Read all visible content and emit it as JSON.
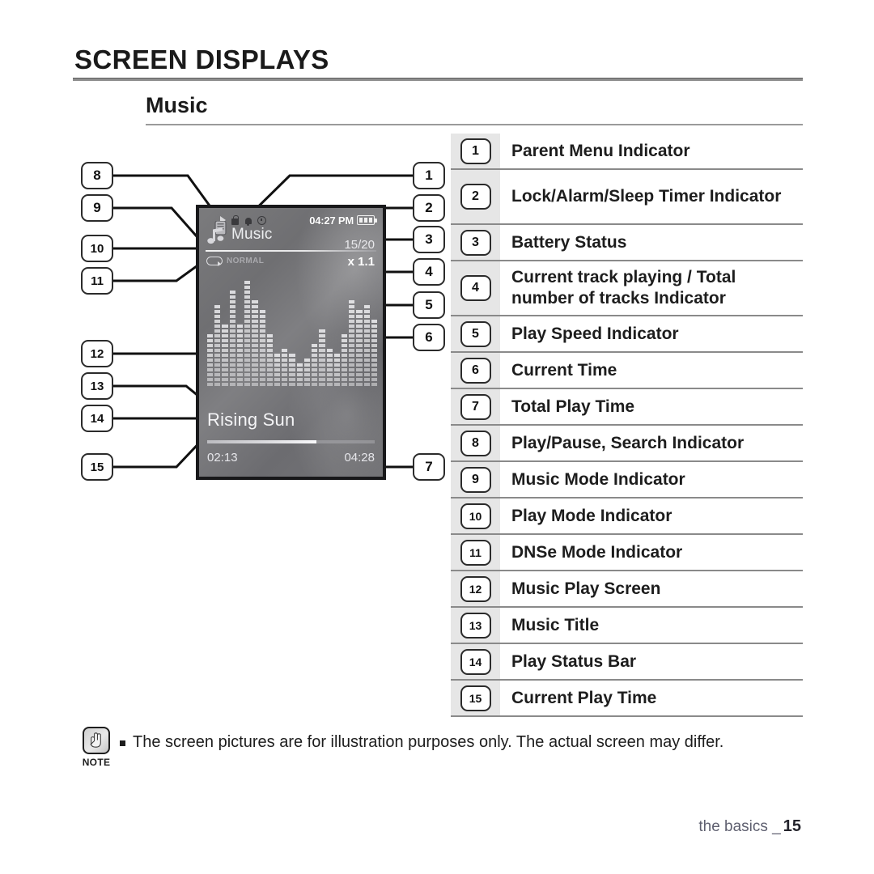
{
  "header": {
    "title": "SCREEN DISPLAYS",
    "section": "Music"
  },
  "device": {
    "menu_label": "Music",
    "icons": {
      "music_mode": "music-note-icon",
      "play_pause": "play-icon",
      "lock": "lock-icon",
      "alarm": "bell-icon",
      "sleep_timer": "clock-icon",
      "battery": "battery-icon",
      "play_mode": "repeat-icon"
    },
    "clock_time": "04:27 PM",
    "track_count": "15/20",
    "play_speed": "x 1.1",
    "dnse_mode": "NORMAL",
    "track_title": "Rising Sun",
    "current_play_time": "02:13",
    "total_play_time": "04:28",
    "progress_percent": 65,
    "equalizer_levels": [
      11,
      17,
      13,
      20,
      13,
      22,
      18,
      16,
      11,
      7,
      8,
      7,
      5,
      6,
      9,
      12,
      8,
      7,
      11,
      18,
      16,
      17,
      14
    ]
  },
  "callouts": [
    {
      "id": "1",
      "label": "1"
    },
    {
      "id": "2",
      "label": "2"
    },
    {
      "id": "3",
      "label": "3"
    },
    {
      "id": "4",
      "label": "4"
    },
    {
      "id": "5",
      "label": "5"
    },
    {
      "id": "6",
      "label": "6"
    },
    {
      "id": "7",
      "label": "7"
    },
    {
      "id": "8",
      "label": "8"
    },
    {
      "id": "9",
      "label": "9"
    },
    {
      "id": "10",
      "label": "10"
    },
    {
      "id": "11",
      "label": "11"
    },
    {
      "id": "12",
      "label": "12"
    },
    {
      "id": "13",
      "label": "13"
    },
    {
      "id": "14",
      "label": "14"
    },
    {
      "id": "15",
      "label": "15"
    }
  ],
  "legend": [
    {
      "num": "1",
      "text": "Parent Menu Indicator"
    },
    {
      "num": "2",
      "text": "Lock/Alarm/Sleep Timer Indicator"
    },
    {
      "num": "3",
      "text": "Battery Status"
    },
    {
      "num": "4",
      "text": "Current track playing / Total number of tracks Indicator"
    },
    {
      "num": "5",
      "text": "Play Speed Indicator"
    },
    {
      "num": "6",
      "text": "Current Time"
    },
    {
      "num": "7",
      "text": "Total Play Time"
    },
    {
      "num": "8",
      "text": "Play/Pause, Search Indicator"
    },
    {
      "num": "9",
      "text": "Music Mode Indicator"
    },
    {
      "num": "10",
      "text": "Play Mode Indicator"
    },
    {
      "num": "11",
      "text": "DNSe Mode Indicator"
    },
    {
      "num": "12",
      "text": "Music Play Screen"
    },
    {
      "num": "13",
      "text": "Music Title"
    },
    {
      "num": "14",
      "text": "Play Status Bar"
    },
    {
      "num": "15",
      "text": "Current Play Time"
    }
  ],
  "note": {
    "label": "NOTE",
    "text": "The screen pictures are for illustration purposes only. The actual screen may differ."
  },
  "footer": {
    "chapter": "the basics _",
    "page": "15"
  }
}
